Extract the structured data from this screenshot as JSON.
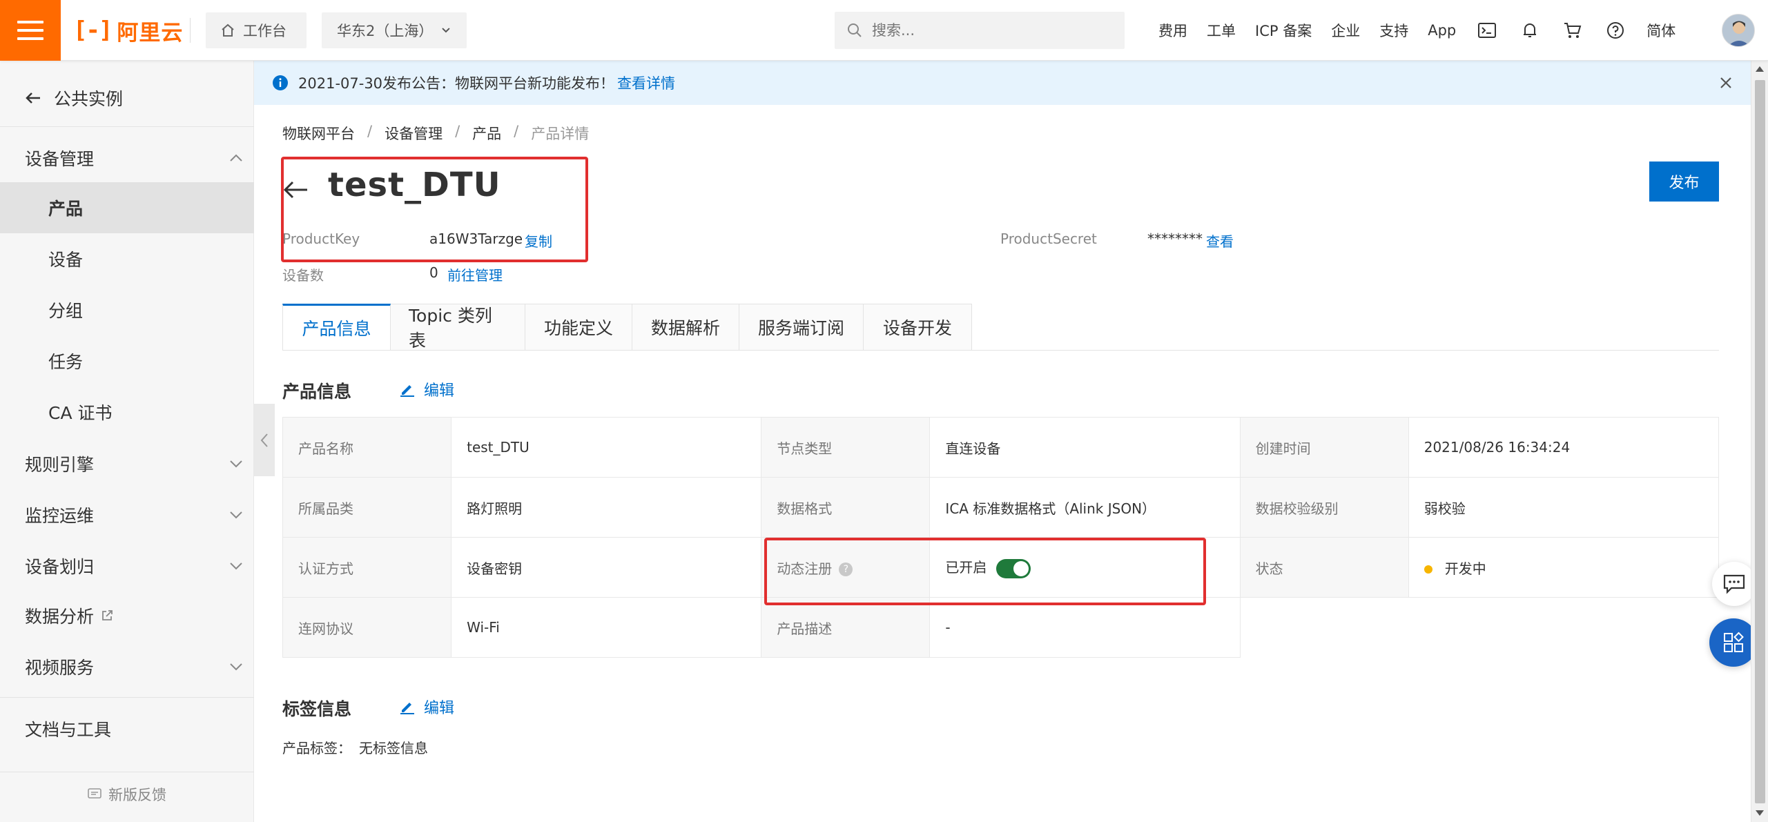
{
  "topbar": {
    "logo_text": "阿里云",
    "workbench_label": "工作台",
    "region_label": "华东2（上海）",
    "search_placeholder": "搜索...",
    "nav": [
      "费用",
      "工单",
      "ICP 备案",
      "企业",
      "支持",
      "App"
    ],
    "language_label": "简体",
    "accent_color": "#ff6a00"
  },
  "sidebar": {
    "back_label": "公共实例",
    "groups": {
      "device_mgmt": "设备管理",
      "rules": "规则引擎",
      "monitoring": "监控运维",
      "device_assign": "设备划归",
      "data_analysis": "数据分析",
      "video": "视频服务",
      "docs": "文档与工具"
    },
    "items": [
      "产品",
      "设备",
      "分组",
      "任务",
      "CA 证书"
    ],
    "active_item": "产品",
    "feedback_label": "新版反馈"
  },
  "banner": {
    "text": "2021-07-30发布公告：物联网平台新功能发布！",
    "link": "查看详情",
    "bg_color": "#e6f3fd"
  },
  "breadcrumb": [
    "物联网平台",
    "设备管理",
    "产品",
    "产品详情"
  ],
  "product": {
    "title": "test_DTU",
    "product_key_label": "ProductKey",
    "product_key_value": "a16W3Tarzge",
    "copy_label": "复制",
    "product_secret_label": "ProductSecret",
    "product_secret_value": "********",
    "view_label": "查看",
    "device_count_label": "设备数",
    "device_count_value": "0",
    "manage_label": "前往管理",
    "publish_label": "发布"
  },
  "tabs": [
    "产品信息",
    "Topic 类列表",
    "功能定义",
    "数据解析",
    "服务端订阅",
    "设备开发"
  ],
  "active_tab": "产品信息",
  "product_info": {
    "section_title": "产品信息",
    "edit_label": "编辑",
    "rows": [
      [
        {
          "k": "产品名称",
          "v": "test_DTU"
        },
        {
          "k": "节点类型",
          "v": "直连设备"
        },
        {
          "k": "创建时间",
          "v": "2021/08/26 16:34:24"
        }
      ],
      [
        {
          "k": "所属品类",
          "v": "路灯照明"
        },
        {
          "k": "数据格式",
          "v": "ICA 标准数据格式（Alink JSON）"
        },
        {
          "k": "数据校验级别",
          "v": "弱校验"
        }
      ],
      [
        {
          "k": "认证方式",
          "v": "设备密钥"
        },
        {
          "k": "动态注册",
          "v": "已开启"
        },
        {
          "k": "状态",
          "v": "开发中"
        }
      ],
      [
        {
          "k": "连网协议",
          "v": "Wi-Fi"
        },
        {
          "k": "产品描述",
          "v": "-"
        }
      ]
    ],
    "dynamic_register_enabled": true,
    "status_color": "#f7b500"
  },
  "tag_info": {
    "section_title": "标签信息",
    "edit_label": "编辑",
    "tags_label": "产品标签：",
    "tags_value": "无标签信息"
  },
  "annotation_color": "#e12f2f"
}
